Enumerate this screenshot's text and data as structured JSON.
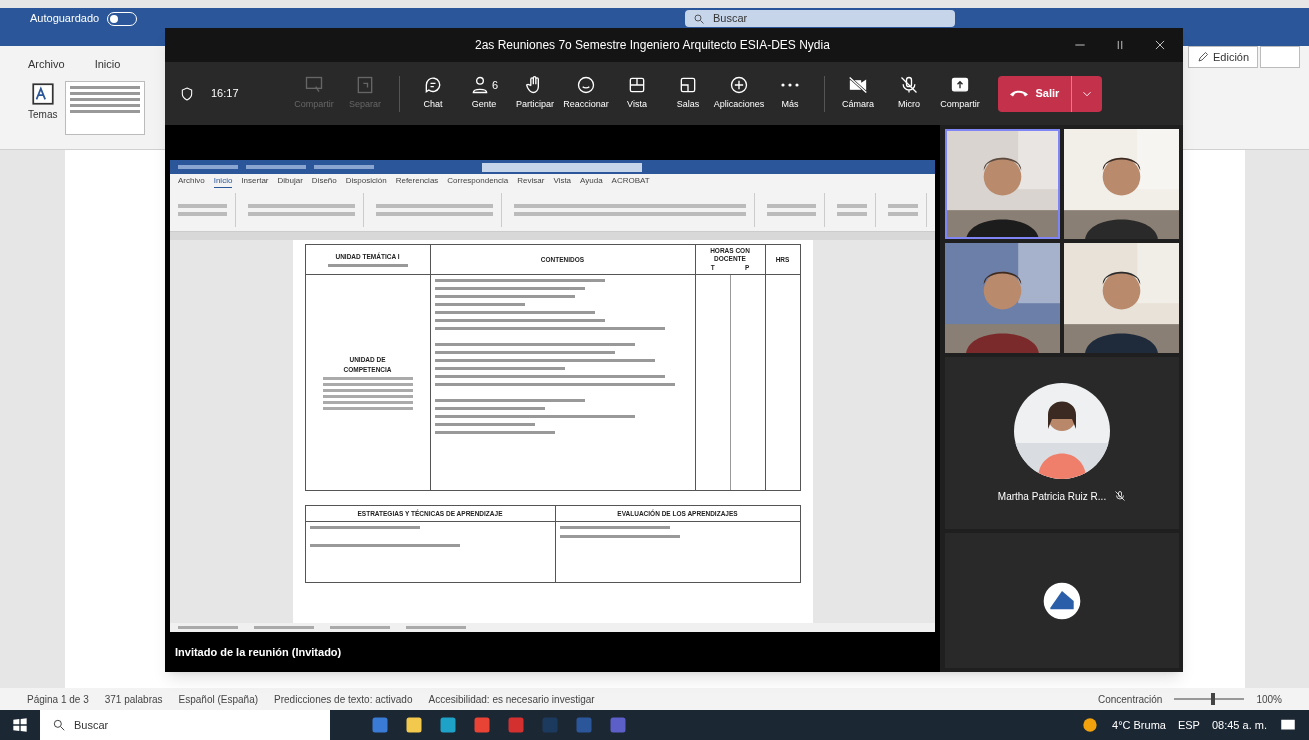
{
  "word": {
    "autosave": {
      "label": "Autoguardado",
      "on": false
    },
    "search": {
      "placeholder": "Buscar"
    },
    "ribbon_tabs": [
      "Archivo",
      "Inicio"
    ],
    "theme_label": "Temas",
    "edit_button": "Edición",
    "status_bar": [
      "Página 1 de 3",
      "371 palabras",
      "Español (España)",
      "Predicciones de texto: activado",
      "Accesibilidad: es necesario investigar"
    ],
    "focus_label": "Concentración",
    "zoom": {
      "level": 0.55,
      "reading": "100%"
    }
  },
  "meeting": {
    "title": "2as Reuniones 7o Semestre Ingeniero Arquitecto ESIA-DES Nydia",
    "timer": "16:17",
    "toolbar": [
      {
        "kind": "tray",
        "label": "Compartir",
        "disabled": true
      },
      {
        "kind": "popout",
        "label": "Separar",
        "disabled": true
      },
      {
        "kind": "chat",
        "label": "Chat",
        "disabled": false
      },
      {
        "kind": "people",
        "label": "Gente",
        "count": "6",
        "disabled": false
      },
      {
        "kind": "hand",
        "label": "Participar",
        "disabled": false
      },
      {
        "kind": "smile",
        "label": "Reaccionar",
        "disabled": false
      },
      {
        "kind": "grid",
        "label": "Vista",
        "disabled": false
      },
      {
        "kind": "rooms",
        "label": "Salas",
        "disabled": false
      },
      {
        "kind": "plus",
        "label": "Aplicaciones",
        "disabled": false
      },
      {
        "kind": "more",
        "label": "Más",
        "disabled": false
      }
    ],
    "devices": [
      {
        "kind": "camera",
        "label": "Cámara",
        "off": true
      },
      {
        "kind": "mic",
        "label": "Micro",
        "off": true
      },
      {
        "kind": "share",
        "label": "Compartir"
      }
    ],
    "leave_button": "Salir",
    "caption": "Invitado de la reunión (Invitado)",
    "video_tiles": [
      {
        "kind": "picture",
        "speaking": true
      },
      {
        "kind": "picture",
        "speaking": false
      },
      {
        "kind": "picture",
        "speaking": false
      },
      {
        "kind": "picture",
        "speaking": false
      }
    ],
    "featured": {
      "name": "Martha Patricia Ruiz R...",
      "muted": true
    }
  },
  "shared_doc": {
    "tabs": [
      {
        "label": "Archivo",
        "selected": false
      },
      {
        "label": "Inicio",
        "selected": true
      },
      {
        "label": "Insertar",
        "selected": false
      },
      {
        "label": "Dibujar",
        "selected": false
      },
      {
        "label": "Diseño",
        "selected": false
      },
      {
        "label": "Disposición",
        "selected": false
      },
      {
        "label": "Referencias",
        "selected": false
      },
      {
        "label": "Correspondencia",
        "selected": false
      },
      {
        "label": "Revisar",
        "selected": false
      },
      {
        "label": "Vista",
        "selected": false
      },
      {
        "label": "Ayuda",
        "selected": false
      },
      {
        "label": "ACROBAT",
        "selected": false
      }
    ],
    "table": {
      "unit_heading": "UNIDAD TEMÁTICA I",
      "contents_heading": "CONTENIDOS",
      "hours_heading": "HORAS CON DOCENTE",
      "hours_columns": [
        "T",
        "P"
      ],
      "extra_heading": "HRS",
      "competence_heading": "UNIDAD DE COMPETENCIA",
      "strategies_heading": "ESTRATEGIAS Y TÉCNICAS DE APRENDIZAJE",
      "evaluation_heading": "EVALUACIÓN DE LOS APRENDIZAJES"
    }
  },
  "taskbar": {
    "search_placeholder": "Buscar",
    "weather": "4°C  Bruma",
    "language": "ESP",
    "time": "08:45 a. m."
  }
}
